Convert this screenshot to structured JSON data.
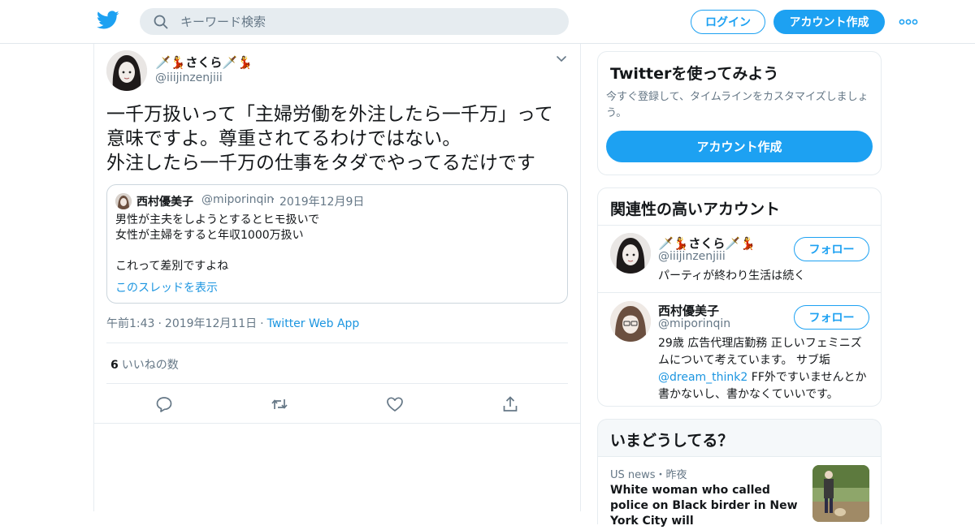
{
  "header": {
    "logo": "twitter-bird-logo",
    "search_placeholder": "キーワード検索",
    "login_label": "ログイン",
    "signup_label": "アカウント作成",
    "brand_color": "#1da1f2"
  },
  "tweet": {
    "display_name": "🗡️💃さくら🗡️💃",
    "handle": "@iiijinzenjiii",
    "text": "一千万扱いって「主婦労働を外注したら一千万」って\n意味ですよ。尊重されてるわけではない。\n外注したら一千万の仕事をタダでやってるだけです",
    "quote": {
      "display_name": "西村優美子",
      "handle": "@miporinqin",
      "date": "2019年12月9日",
      "text": "男性が主夫をしようとするとヒモ扱いで\n女性が主婦をすると年収1000万扱い\n\nこれって差別ですよね",
      "thread_link": "このスレッドを表示"
    },
    "time": "午前1:43",
    "date": "2019年12月11日",
    "app": "Twitter Web App",
    "like_count": "6",
    "like_label": "いいねの数"
  },
  "sidebar": {
    "signup_card": {
      "title": "Twitterを使ってみよう",
      "description": "今すぐ登録して、タイムラインをカスタマイズしましょう。",
      "button": "アカウント作成"
    },
    "related": {
      "title": "関連性の高いアカウント",
      "accounts": [
        {
          "display_name": "🗡️💃さくら🗡️💃",
          "handle": "@iiijinzenjiii",
          "bio": "パーティが終わり生活は続く",
          "follow_label": "フォロー"
        },
        {
          "display_name": "西村優美子",
          "handle": "@miporinqin",
          "bio_before": "29歳 広告代理店勤務 正しいフェミニズムについて考えています。 サブ垢 ",
          "bio_link": "@dream_think2",
          "bio_after": " FF外ですいませんとか書かないし、書かなくていいです。",
          "follow_label": "フォロー"
        }
      ]
    },
    "trends": {
      "title": "いまどうしてる？",
      "items": [
        {
          "meta": "US news・昨夜",
          "title": "White woman who called police on Black birder in New York City will"
        }
      ]
    }
  }
}
